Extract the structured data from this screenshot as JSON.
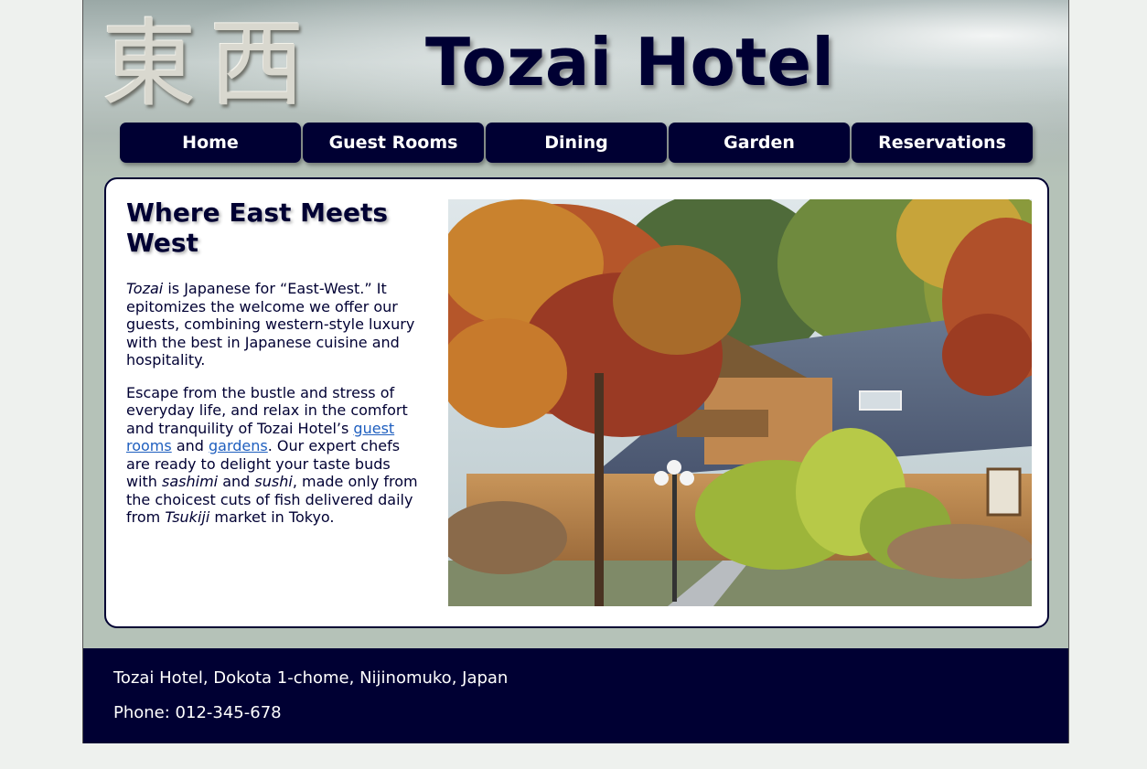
{
  "banner": {
    "kanji": "東西",
    "title": "Tozai Hotel"
  },
  "nav": {
    "items": [
      {
        "label": "Home"
      },
      {
        "label": "Guest Rooms"
      },
      {
        "label": "Dining"
      },
      {
        "label": "Garden"
      },
      {
        "label": "Reservations"
      }
    ]
  },
  "main": {
    "headline": "Where East Meets West",
    "intro": {
      "term": "Tozai",
      "rest": " is Japanese for “East-West.” It epitomizes the welcome we offer our guests, combining western-style luxury with the best in Japanese cuisine and hospitality."
    },
    "escape": {
      "t1": "Escape from the bustle and stress of everyday life, and relax in the comfort and tranquility of Tozai Hotel’s ",
      "link_rooms": "guest rooms",
      "t2": " and ",
      "link_gardens": "gardens",
      "t3": ". Our expert chefs are ready to delight your taste buds with ",
      "em1": "sashimi",
      "t4": " and ",
      "em2": "sushi",
      "t5": ", made only from the choicest cuts of fish delivered daily from ",
      "em3": "Tsukiji",
      "t6": " market in Tokyo."
    }
  },
  "footer": {
    "address": "Tozai Hotel, Dokota 1-chome, Nijinomuko, Japan",
    "phone": "Phone: 012-345-678"
  }
}
